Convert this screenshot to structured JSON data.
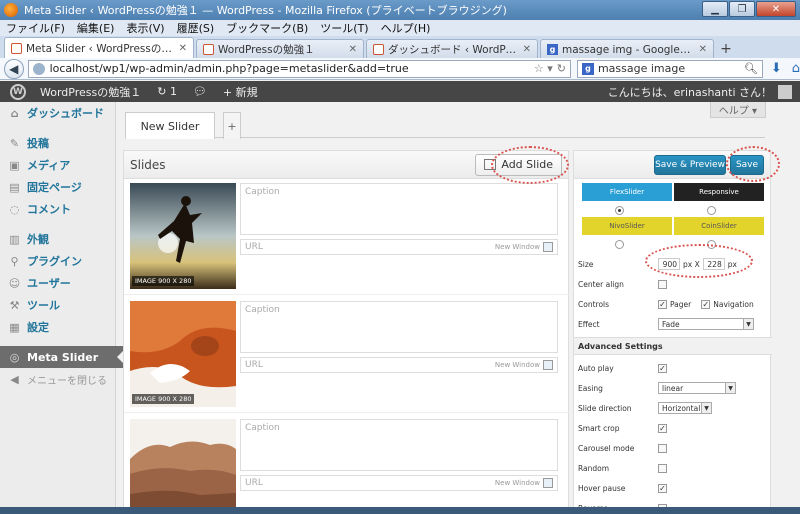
{
  "window": {
    "title": "Meta Slider ‹ WordPressの勉強１ — WordPress - Mozilla Firefox (プライベートブラウジング)"
  },
  "menubar": [
    "ファイル(F)",
    "編集(E)",
    "表示(V)",
    "履歴(S)",
    "ブックマーク(B)",
    "ツール(T)",
    "ヘルプ(H)"
  ],
  "tabs": [
    {
      "label": "Meta Slider ‹ WordPressの勉強１ ...",
      "icon": "wordpress-icon",
      "active": true
    },
    {
      "label": "WordPressの勉強１",
      "icon": "wordpress-icon",
      "active": false
    },
    {
      "label": "ダッシュボード ‹ WordPressの勉...",
      "icon": "wordpress-icon",
      "active": false
    },
    {
      "label": "massage img - Google 検索",
      "icon": "google-icon",
      "active": false
    }
  ],
  "navbar": {
    "url": "localhost/wp1/wp-admin/admin.php?page=metaslider&add=true",
    "search": "massage image"
  },
  "adminbar": {
    "site": "WordPressの勉強１",
    "updates": "1",
    "new": "新規",
    "greeting": "こんにちは、erinashanti さん！"
  },
  "sidebar": {
    "items": [
      {
        "label": "ダッシュボード",
        "icon": "dashboard-icon"
      },
      {
        "label": "投稿",
        "icon": "pin-icon"
      },
      {
        "label": "メディア",
        "icon": "media-icon"
      },
      {
        "label": "固定ページ",
        "icon": "page-icon"
      },
      {
        "label": "コメント",
        "icon": "comment-icon"
      },
      {
        "label": "外観",
        "icon": "appearance-icon"
      },
      {
        "label": "プラグイン",
        "icon": "plugin-icon"
      },
      {
        "label": "ユーザー",
        "icon": "users-icon"
      },
      {
        "label": "ツール",
        "icon": "tools-icon"
      },
      {
        "label": "設定",
        "icon": "settings-icon"
      },
      {
        "label": "Meta Slider",
        "icon": "slider-icon"
      }
    ],
    "collapse": "メニューを閉じる"
  },
  "help": "ヘルプ ▾",
  "slider_tabs": {
    "current": "New Slider",
    "add": "+"
  },
  "slides": {
    "heading": "Slides",
    "add_button": "Add Slide",
    "caption_placeholder": "Caption",
    "url_placeholder": "URL",
    "new_window": "New Window",
    "badge": "IMAGE 900 X 280"
  },
  "settings": {
    "preview_button": "Save & Preview",
    "save_button": "Save",
    "types": {
      "flex": "FlexSlider",
      "responsive": "Responsive",
      "nivo": "NivoSlider",
      "coin": "CoinSlider"
    },
    "size_label": "Size",
    "width": "900",
    "height": "228",
    "px_x": "px X",
    "px": "px",
    "center_align": "Center align",
    "controls": "Controls",
    "pager": "Pager",
    "navigation": "Navigation",
    "effect": "Effect",
    "effect_value": "Fade",
    "advanced": "Advanced Settings",
    "auto_play": "Auto play",
    "easing": "Easing",
    "easing_value": "linear",
    "slide_direction": "Slide direction",
    "direction_value": "Horizontal",
    "smart_crop": "Smart crop",
    "carousel_mode": "Carousel mode",
    "random": "Random",
    "hover_pause": "Hover pause",
    "reverse": "Reverse"
  },
  "colors": {
    "wp_blue": "#21759b",
    "flexslider": "#2a9fd6",
    "responsive": "#222222",
    "nivo_coin": "#e3d42c",
    "annotation_red": "#d9534f"
  }
}
